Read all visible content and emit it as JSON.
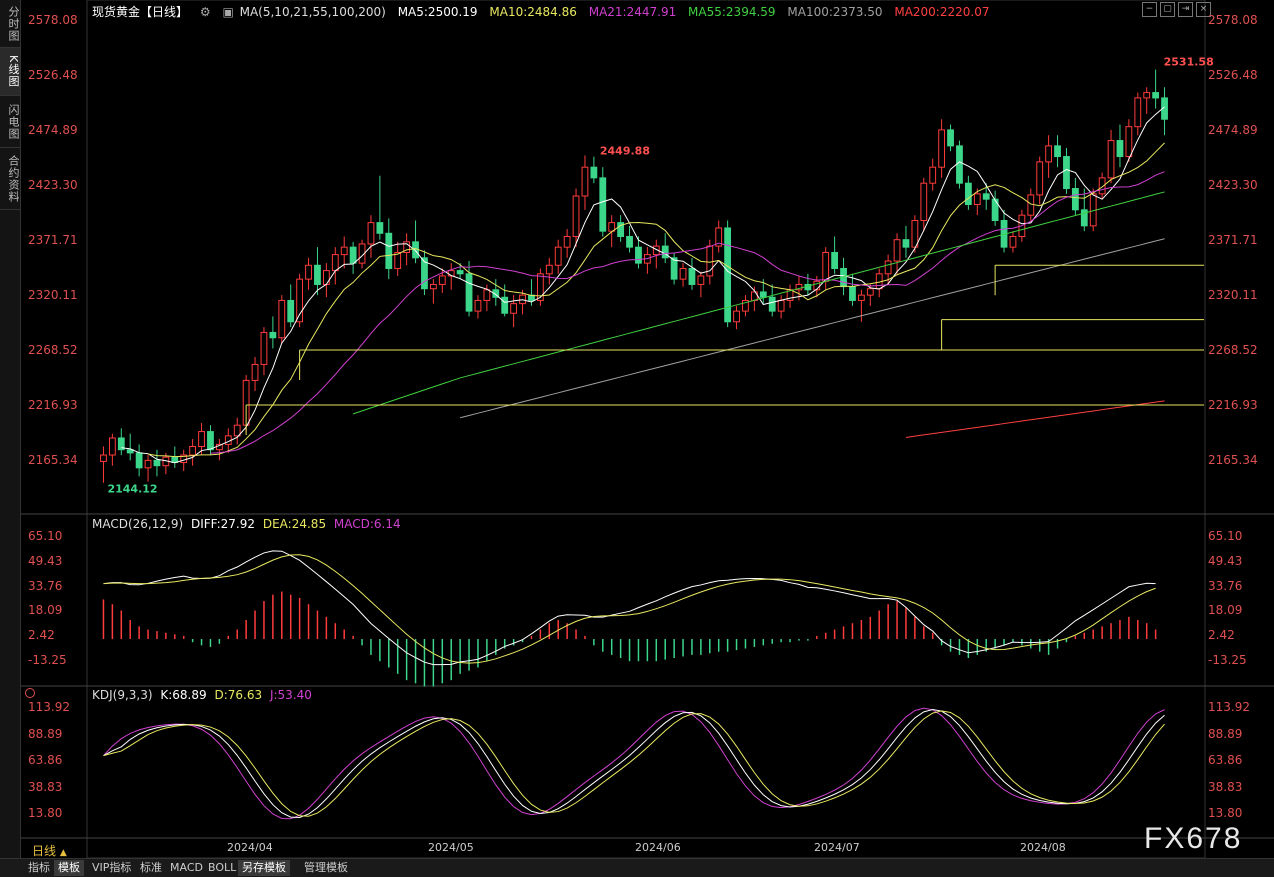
{
  "sidebar": {
    "tabs": [
      "分时图",
      "K线图",
      "闪电图",
      "合约资料"
    ],
    "active": 1
  },
  "main_header": {
    "title": "现货黄金【日线】",
    "settings_icon": "gear-icon",
    "ma_label": "MA(5,10,21,55,100,200)",
    "ma_values": [
      {
        "label": "MA5:2500.19",
        "color": "#ffffff"
      },
      {
        "label": "MA10:2484.86",
        "color": "#e8e860"
      },
      {
        "label": "MA21:2447.91",
        "color": "#d040d0"
      },
      {
        "label": "MA55:2394.59",
        "color": "#40d040"
      },
      {
        "label": "MA100:2373.50",
        "color": "#a0a0a0"
      },
      {
        "label": "MA200:2220.07",
        "color": "#ff4040"
      }
    ]
  },
  "main_axis_labels": [
    "2578.08",
    "2526.48",
    "2474.89",
    "2423.30",
    "2371.71",
    "2320.11",
    "2268.52",
    "2216.93",
    "2165.34"
  ],
  "price_annotations": {
    "high": "2531.58",
    "mid_high": "2449.88",
    "low": "2144.12"
  },
  "macd_header": {
    "label": "MACD(26,12,9)",
    "diff": "DIFF:27.92",
    "dea": "DEA:24.85",
    "macd": "MACD:6.14"
  },
  "macd_axis_labels": [
    "65.10",
    "49.43",
    "33.76",
    "18.09",
    "2.42",
    "-13.25"
  ],
  "kdj_header": {
    "label": "KDJ(9,3,3)",
    "k": "K:68.89",
    "d": "D:76.63",
    "j": "J:53.40"
  },
  "kdj_axis_labels": [
    "113.92",
    "88.89",
    "63.86",
    "38.83",
    "13.80"
  ],
  "x_axis_labels": [
    "2024/04",
    "2024/05",
    "2024/06",
    "2024/07",
    "2024/08"
  ],
  "period_label": "日线",
  "watermark": "FX678",
  "bottom_tabs": [
    "指标",
    "模板",
    "VIP指标",
    "标准",
    "MACD",
    "BOLL",
    "另存模板",
    "管理模板"
  ],
  "bottom_active": [
    1,
    6
  ],
  "colors": {
    "up": "#ff3b3b",
    "down": "#3bd68a",
    "level": "#e8e860"
  },
  "chart_data": {
    "type": "candlestick",
    "ylim": [
      2130,
      2578.08
    ],
    "candles_ohlc": [
      [
        2164,
        2178,
        2144,
        2170
      ],
      [
        2170,
        2190,
        2160,
        2186
      ],
      [
        2186,
        2195,
        2170,
        2175
      ],
      [
        2175,
        2190,
        2165,
        2172
      ],
      [
        2172,
        2180,
        2150,
        2158
      ],
      [
        2158,
        2170,
        2145,
        2165
      ],
      [
        2165,
        2175,
        2150,
        2160
      ],
      [
        2160,
        2172,
        2152,
        2168
      ],
      [
        2168,
        2178,
        2158,
        2163
      ],
      [
        2163,
        2175,
        2155,
        2170
      ],
      [
        2170,
        2185,
        2160,
        2178
      ],
      [
        2178,
        2200,
        2170,
        2192
      ],
      [
        2192,
        2198,
        2170,
        2175
      ],
      [
        2175,
        2185,
        2165,
        2180
      ],
      [
        2180,
        2195,
        2172,
        2188
      ],
      [
        2188,
        2205,
        2180,
        2198
      ],
      [
        2198,
        2245,
        2192,
        2240
      ],
      [
        2240,
        2262,
        2230,
        2255
      ],
      [
        2255,
        2290,
        2245,
        2285
      ],
      [
        2285,
        2300,
        2270,
        2280
      ],
      [
        2280,
        2320,
        2275,
        2315
      ],
      [
        2315,
        2330,
        2290,
        2295
      ],
      [
        2295,
        2340,
        2290,
        2335
      ],
      [
        2335,
        2355,
        2325,
        2348
      ],
      [
        2348,
        2365,
        2320,
        2330
      ],
      [
        2330,
        2350,
        2318,
        2343
      ],
      [
        2343,
        2365,
        2330,
        2358
      ],
      [
        2358,
        2375,
        2345,
        2365
      ],
      [
        2365,
        2370,
        2340,
        2350
      ],
      [
        2350,
        2372,
        2345,
        2368
      ],
      [
        2368,
        2395,
        2355,
        2388
      ],
      [
        2388,
        2432,
        2372,
        2378
      ],
      [
        2378,
        2392,
        2335,
        2345
      ],
      [
        2345,
        2370,
        2338,
        2360
      ],
      [
        2360,
        2378,
        2348,
        2370
      ],
      [
        2370,
        2390,
        2350,
        2355
      ],
      [
        2355,
        2362,
        2320,
        2326
      ],
      [
        2326,
        2335,
        2312,
        2330
      ],
      [
        2330,
        2345,
        2322,
        2338
      ],
      [
        2338,
        2350,
        2325,
        2343
      ],
      [
        2343,
        2350,
        2335,
        2340
      ],
      [
        2340,
        2352,
        2300,
        2305
      ],
      [
        2305,
        2320,
        2298,
        2315
      ],
      [
        2315,
        2330,
        2305,
        2325
      ],
      [
        2325,
        2335,
        2310,
        2318
      ],
      [
        2318,
        2330,
        2300,
        2303
      ],
      [
        2303,
        2320,
        2290,
        2312
      ],
      [
        2312,
        2325,
        2302,
        2320
      ],
      [
        2320,
        2335,
        2310,
        2315
      ],
      [
        2315,
        2345,
        2310,
        2340
      ],
      [
        2340,
        2355,
        2330,
        2348
      ],
      [
        2348,
        2372,
        2340,
        2365
      ],
      [
        2365,
        2382,
        2355,
        2375
      ],
      [
        2375,
        2420,
        2365,
        2413
      ],
      [
        2413,
        2451,
        2400,
        2440
      ],
      [
        2440,
        2449.88,
        2425,
        2430
      ],
      [
        2430,
        2440,
        2375,
        2380
      ],
      [
        2380,
        2395,
        2365,
        2388
      ],
      [
        2388,
        2395,
        2370,
        2375
      ],
      [
        2375,
        2385,
        2360,
        2365
      ],
      [
        2365,
        2375,
        2345,
        2350
      ],
      [
        2350,
        2365,
        2340,
        2358
      ],
      [
        2358,
        2372,
        2345,
        2366
      ],
      [
        2366,
        2378,
        2350,
        2355
      ],
      [
        2355,
        2360,
        2330,
        2335
      ],
      [
        2335,
        2350,
        2328,
        2345
      ],
      [
        2345,
        2355,
        2325,
        2330
      ],
      [
        2330,
        2342,
        2318,
        2338
      ],
      [
        2338,
        2372,
        2330,
        2366
      ],
      [
        2366,
        2390,
        2360,
        2383
      ],
      [
        2383,
        2390,
        2290,
        2295
      ],
      [
        2295,
        2310,
        2288,
        2305
      ],
      [
        2305,
        2320,
        2300,
        2315
      ],
      [
        2315,
        2328,
        2305,
        2323
      ],
      [
        2323,
        2335,
        2312,
        2318
      ],
      [
        2318,
        2330,
        2300,
        2305
      ],
      [
        2305,
        2320,
        2298,
        2315
      ],
      [
        2315,
        2330,
        2308,
        2325
      ],
      [
        2325,
        2338,
        2315,
        2330
      ],
      [
        2330,
        2340,
        2320,
        2325
      ],
      [
        2325,
        2338,
        2318,
        2333
      ],
      [
        2333,
        2365,
        2325,
        2360
      ],
      [
        2360,
        2375,
        2340,
        2345
      ],
      [
        2345,
        2355,
        2320,
        2328
      ],
      [
        2328,
        2340,
        2310,
        2315
      ],
      [
        2315,
        2325,
        2295,
        2320
      ],
      [
        2320,
        2330,
        2310,
        2326
      ],
      [
        2326,
        2345,
        2318,
        2340
      ],
      [
        2340,
        2358,
        2330,
        2352
      ],
      [
        2352,
        2378,
        2340,
        2372
      ],
      [
        2372,
        2385,
        2355,
        2365
      ],
      [
        2365,
        2395,
        2360,
        2390
      ],
      [
        2390,
        2430,
        2380,
        2425
      ],
      [
        2425,
        2448,
        2418,
        2440
      ],
      [
        2440,
        2485,
        2430,
        2475
      ],
      [
        2475,
        2480,
        2455,
        2460
      ],
      [
        2460,
        2465,
        2420,
        2425
      ],
      [
        2425,
        2432,
        2400,
        2405
      ],
      [
        2405,
        2420,
        2395,
        2415
      ],
      [
        2415,
        2425,
        2400,
        2410
      ],
      [
        2410,
        2418,
        2385,
        2390
      ],
      [
        2390,
        2400,
        2360,
        2365
      ],
      [
        2365,
        2380,
        2360,
        2375
      ],
      [
        2375,
        2400,
        2370,
        2395
      ],
      [
        2395,
        2420,
        2390,
        2414
      ],
      [
        2414,
        2450,
        2405,
        2445
      ],
      [
        2445,
        2470,
        2430,
        2460
      ],
      [
        2460,
        2470,
        2440,
        2450
      ],
      [
        2450,
        2458,
        2415,
        2420
      ],
      [
        2420,
        2430,
        2395,
        2400
      ],
      [
        2400,
        2420,
        2380,
        2385
      ],
      [
        2385,
        2420,
        2380,
        2415
      ],
      [
        2415,
        2435,
        2410,
        2430
      ],
      [
        2430,
        2475,
        2425,
        2465
      ],
      [
        2465,
        2480,
        2440,
        2450
      ],
      [
        2450,
        2485,
        2445,
        2478
      ],
      [
        2478,
        2510,
        2470,
        2505
      ],
      [
        2505,
        2515,
        2490,
        2510
      ],
      [
        2510,
        2531.58,
        2495,
        2505
      ],
      [
        2505,
        2515,
        2470,
        2485
      ]
    ],
    "macd_hist": [
      25,
      22,
      18,
      12,
      8,
      6,
      5,
      4,
      3,
      2,
      -2,
      -4,
      -5,
      -3,
      2,
      6,
      12,
      18,
      24,
      28,
      30,
      28,
      26,
      22,
      18,
      14,
      10,
      6,
      2,
      -4,
      -10,
      -14,
      -18,
      -22,
      -26,
      -28,
      -30,
      -30,
      -28,
      -26,
      -22,
      -20,
      -18,
      -14,
      -10,
      -6,
      -4,
      -2,
      2,
      6,
      10,
      12,
      10,
      6,
      2,
      -4,
      -8,
      -10,
      -12,
      -14,
      -14,
      -14,
      -14,
      -13,
      -12,
      -11,
      -10,
      -10,
      -9,
      -8,
      -8,
      -7,
      -6,
      -5,
      -4,
      -3,
      -2,
      -2,
      -1,
      -1,
      2,
      4,
      6,
      8,
      10,
      12,
      14,
      18,
      22,
      24,
      20,
      14,
      8,
      4,
      -4,
      -8,
      -10,
      -12,
      -10,
      -8,
      -6,
      -4,
      -2,
      -4,
      -6,
      -8,
      -10,
      -6,
      -2,
      2,
      4,
      6,
      8,
      10,
      12,
      14,
      12,
      10,
      6
    ],
    "macd_ylim": [
      -13.25,
      65.1
    ],
    "kdj_ylim": [
      13.8,
      113.92
    ]
  }
}
